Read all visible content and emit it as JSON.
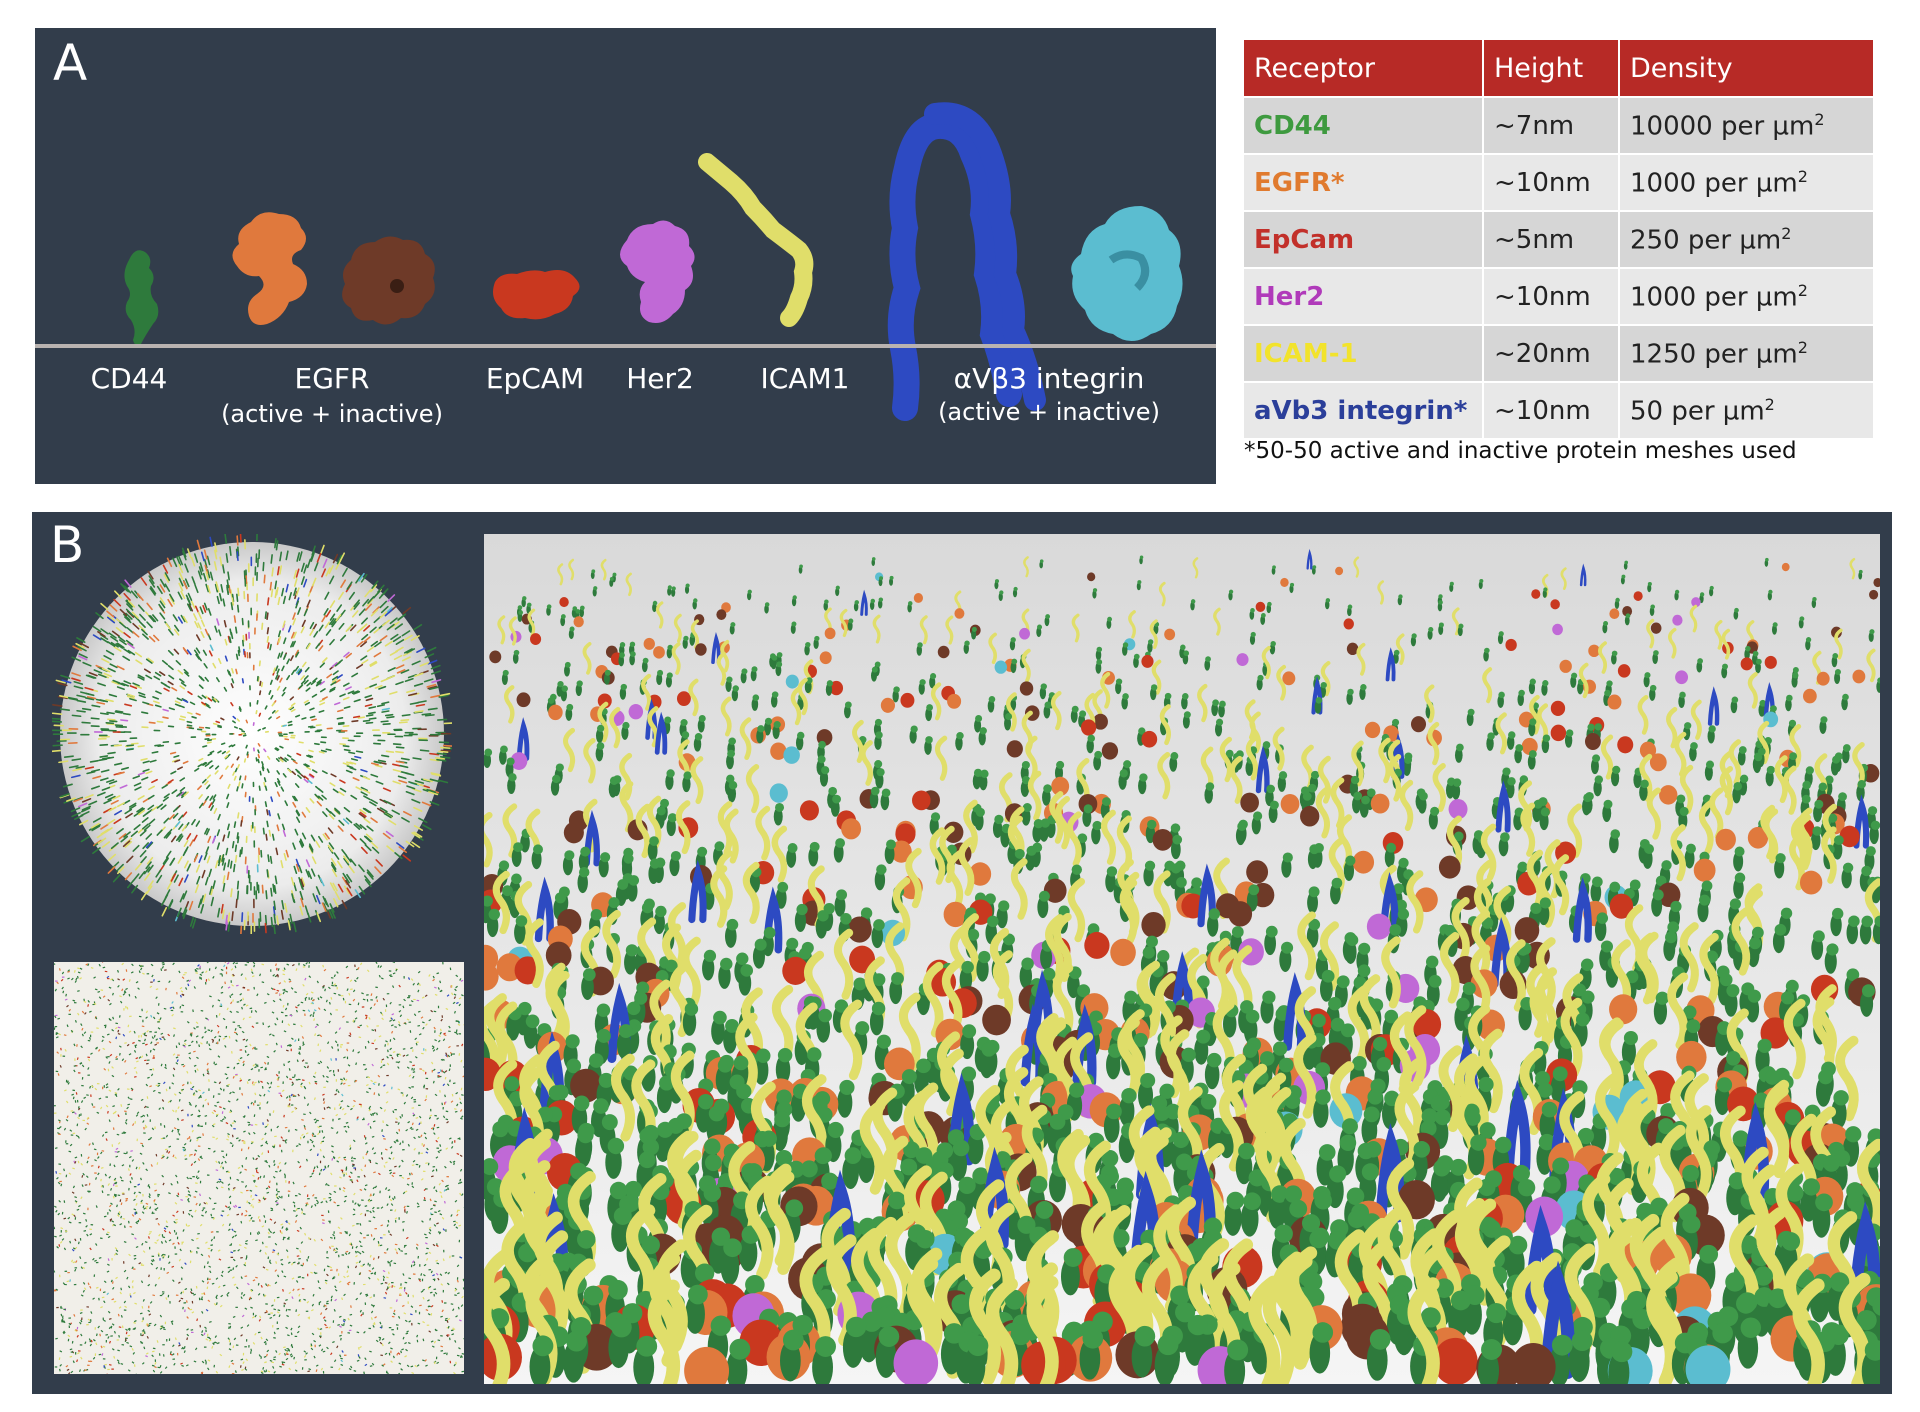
{
  "panel_a": {
    "letter": "A",
    "receptors": [
      {
        "label": "CD44",
        "sub": ""
      },
      {
        "label": "EGFR",
        "sub": "(active + inactive)"
      },
      {
        "label": "EpCAM",
        "sub": ""
      },
      {
        "label": "Her2",
        "sub": ""
      },
      {
        "label": "ICAM1",
        "sub": ""
      },
      {
        "label": "αVβ3 integrin",
        "sub": "(active + inactive)"
      }
    ]
  },
  "table": {
    "headers": [
      "Receptor",
      "Height",
      "Density"
    ],
    "unit_sup": "2",
    "rows": [
      {
        "name": "CD44",
        "color": "#3e9a3f",
        "height": "~7nm",
        "density": "10000 per µm"
      },
      {
        "name": "EGFR*",
        "color": "#e07a2e",
        "height": "~10nm",
        "density": "1000 per µm"
      },
      {
        "name": "EpCam",
        "color": "#c2302a",
        "height": "~5nm",
        "density": "250 per µm"
      },
      {
        "name": "Her2",
        "color": "#b03aba",
        "height": "~10nm",
        "density": "1000 per µm"
      },
      {
        "name": "ICAM-1",
        "color": "#f2e32c",
        "height": "~20nm",
        "density": "1250 per µm"
      },
      {
        "name": "aVb3 integrin*",
        "color": "#2b3f9a",
        "height": "~10nm",
        "density": "50 per µm"
      }
    ],
    "footnote": "*50-50 active and inactive protein meshes used"
  },
  "panel_b": {
    "letter": "B"
  },
  "colors": {
    "cd44": "#2e7a3c",
    "egfr_active": "#e0793d",
    "egfr_inactive": "#6e3a28",
    "epcam": "#c9381f",
    "her2": "#c069d6",
    "icam1": "#e0de6a",
    "integrin": "#2d4ac2",
    "integrin_inactive": "#5bbdd0",
    "panel_bg": "#323d4b",
    "header_red": "#b72a26"
  }
}
